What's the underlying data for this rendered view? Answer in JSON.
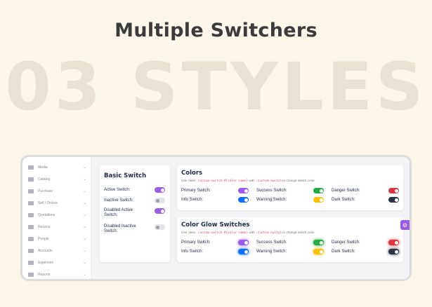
{
  "headline": "Multiple Switchers",
  "big_text": "03 STYLES",
  "colors": {
    "purple": "#9b5de5",
    "green": "#28a745",
    "red": "#dc3545",
    "blue": "#0d6efd",
    "yellow": "#ffc107",
    "dark": "#2b3445",
    "off": "#e2e4e8"
  },
  "sidebar": {
    "items": [
      {
        "label": "Media",
        "icon": "media-icon"
      },
      {
        "label": "Catalog",
        "icon": "catalog-icon"
      },
      {
        "label": "Purchase",
        "icon": "purchase-icon"
      },
      {
        "label": "Sell / Orders",
        "icon": "orders-icon"
      },
      {
        "label": "Quotations",
        "icon": "quote-icon"
      },
      {
        "label": "Returns",
        "icon": "returns-icon"
      },
      {
        "label": "People",
        "icon": "people-icon"
      },
      {
        "label": "Accounts",
        "icon": "accounts-icon"
      },
      {
        "label": "Expenses",
        "icon": "expenses-icon"
      },
      {
        "label": "Reports",
        "icon": "reports-icon"
      }
    ]
  },
  "basic": {
    "title": "Basic Switch",
    "switches": [
      {
        "label": "Active Switch:",
        "state": "on"
      },
      {
        "label": "Inactive Switch:",
        "state": "off"
      },
      {
        "label": "Disabled Active Switch:",
        "state": "on"
      },
      {
        "label": "Disabled Inactive Switch:",
        "state": "off"
      }
    ]
  },
  "colors_card": {
    "title": "Colors",
    "sub_prefix": "Use class",
    "sub_code1": ".custom-switch-#{color-name}",
    "sub_mid": "with",
    "sub_code2": ".custom-switch",
    "sub_suffix": "to change switch color",
    "switches": [
      {
        "label": "Primary Switch:",
        "color": "purple"
      },
      {
        "label": "Success Switch:",
        "color": "green"
      },
      {
        "label": "Danger Switch:",
        "color": "red"
      },
      {
        "label": "Info Switch:",
        "color": "blue"
      },
      {
        "label": "Warning Switch:",
        "color": "yellow"
      },
      {
        "label": "Dark Switch:",
        "color": "dark"
      }
    ]
  },
  "glow_card": {
    "title": "Color Glow Switches",
    "sub_prefix": "Use class",
    "sub_code1": ".custom-switch-#{color-name}",
    "sub_mid": "with",
    "sub_code2": ".custom-switch",
    "sub_suffix": "to change switch color",
    "switches": [
      {
        "label": "Primary Switch:",
        "color": "purple"
      },
      {
        "label": "Success Switch:",
        "color": "green"
      },
      {
        "label": "Danger Switch:",
        "color": "red"
      },
      {
        "label": "Info Switch:",
        "color": "blue"
      },
      {
        "label": "Warning Switch:",
        "color": "yellow"
      },
      {
        "label": "Dark Switch:",
        "color": "dark"
      }
    ]
  },
  "settings_tab": {
    "icon": "gear-icon"
  }
}
